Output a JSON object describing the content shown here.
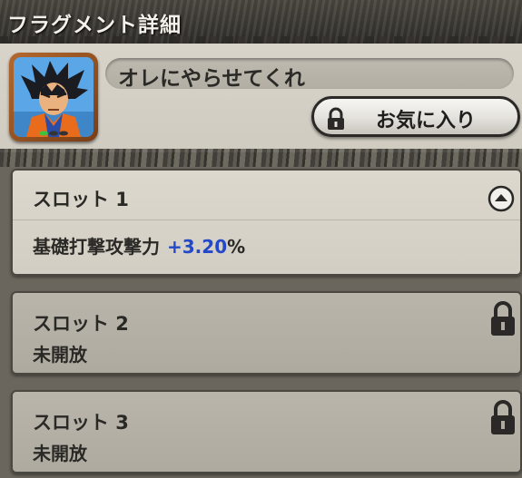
{
  "header": {
    "title": "フラグメント詳細"
  },
  "fragment": {
    "name": "オレにやらせてくれ",
    "favorite_button": "お気に入り"
  },
  "slots": [
    {
      "label": "スロット 1",
      "stat_name": "基礎打撃攻撃力",
      "stat_value": "+3.20",
      "stat_unit": "%",
      "expanded": true
    },
    {
      "label": "スロット 2",
      "status": "未開放",
      "locked": true
    },
    {
      "label": "スロット 3",
      "status": "未開放",
      "locked": true
    }
  ],
  "colors": {
    "stat_value": "#2348c9",
    "card_open": "#dcd8ce",
    "card_locked": "#b9b5ab"
  },
  "icons": {
    "favorite": "lock-icon",
    "slot1": "collapse-arrow-icon",
    "slot2": "lock-icon",
    "slot3": "lock-icon"
  }
}
